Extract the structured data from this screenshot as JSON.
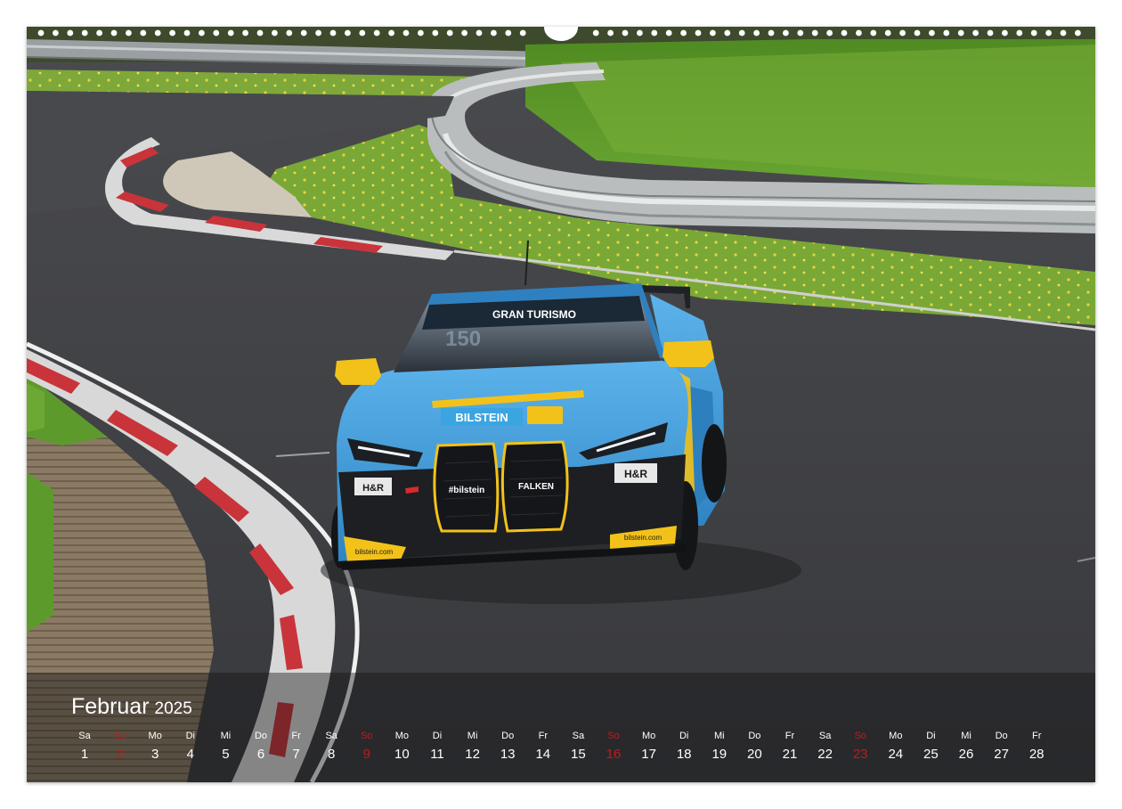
{
  "calendar": {
    "month": "Februar",
    "year": "2025",
    "days": [
      {
        "wd": "Sa",
        "d": "1",
        "sun": false
      },
      {
        "wd": "So",
        "d": "2",
        "sun": true
      },
      {
        "wd": "Mo",
        "d": "3",
        "sun": false
      },
      {
        "wd": "Di",
        "d": "4",
        "sun": false
      },
      {
        "wd": "Mi",
        "d": "5",
        "sun": false
      },
      {
        "wd": "Do",
        "d": "6",
        "sun": false
      },
      {
        "wd": "Fr",
        "d": "7",
        "sun": false
      },
      {
        "wd": "Sa",
        "d": "8",
        "sun": false
      },
      {
        "wd": "So",
        "d": "9",
        "sun": true
      },
      {
        "wd": "Mo",
        "d": "10",
        "sun": false
      },
      {
        "wd": "Di",
        "d": "11",
        "sun": false
      },
      {
        "wd": "Mi",
        "d": "12",
        "sun": false
      },
      {
        "wd": "Do",
        "d": "13",
        "sun": false
      },
      {
        "wd": "Fr",
        "d": "14",
        "sun": false
      },
      {
        "wd": "Sa",
        "d": "15",
        "sun": false
      },
      {
        "wd": "So",
        "d": "16",
        "sun": true
      },
      {
        "wd": "Mo",
        "d": "17",
        "sun": false
      },
      {
        "wd": "Di",
        "d": "18",
        "sun": false
      },
      {
        "wd": "Mi",
        "d": "19",
        "sun": false
      },
      {
        "wd": "Do",
        "d": "20",
        "sun": false
      },
      {
        "wd": "Fr",
        "d": "21",
        "sun": false
      },
      {
        "wd": "Sa",
        "d": "22",
        "sun": false
      },
      {
        "wd": "So",
        "d": "23",
        "sun": true
      },
      {
        "wd": "Mo",
        "d": "24",
        "sun": false
      },
      {
        "wd": "Di",
        "d": "25",
        "sun": false
      },
      {
        "wd": "Mi",
        "d": "26",
        "sun": false
      },
      {
        "wd": "Do",
        "d": "27",
        "sun": false
      },
      {
        "wd": "Fr",
        "d": "28",
        "sun": false
      }
    ]
  },
  "car": {
    "number": "150",
    "windscreen_banner": "GRAN TURISMO",
    "hood_sponsor": "BILSTEIN",
    "grille_left": "#bilstein",
    "grille_right": "FALKEN",
    "bumper_left_badge": "H&R",
    "bumper_right_badge": "H&R",
    "splitter_left": "bilstein.com",
    "splitter_right": "bilstein.com"
  },
  "colors": {
    "car_blue": "#3f9ad8",
    "car_yellow": "#f2c21a",
    "asphalt": "#3c3d40",
    "grass": "#5d9a2c",
    "kerb_red": "#c8343a",
    "sunday_red": "#c21a1a"
  }
}
